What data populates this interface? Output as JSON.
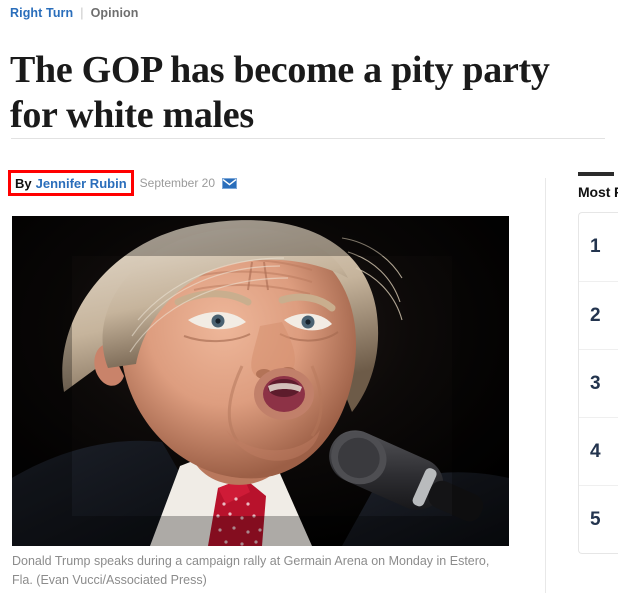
{
  "kicker": {
    "brand": "Right Turn",
    "separator": "|",
    "section": "Opinion"
  },
  "article": {
    "headline": "The GOP has become a pity party\nfor white males",
    "byline_prefix": "By",
    "author": "Jennifer Rubin",
    "date": "September 20",
    "email_icon": "envelope-icon"
  },
  "photo": {
    "caption": "Donald Trump speaks during a campaign rally at Germain Arena on Monday in Estero, Fla. (Evan Vucci/Associated Press)",
    "alt": "Donald Trump speaking into a microphone at a campaign rally"
  },
  "sidebar": {
    "title": "Most R",
    "items": [
      {
        "rank": "1"
      },
      {
        "rank": "2"
      },
      {
        "rank": "3"
      },
      {
        "rank": "4"
      },
      {
        "rank": "5"
      }
    ]
  },
  "colors": {
    "brand_blue": "#2a6ebb",
    "highlight_red": "#ff0000",
    "caption_gray": "#8c8c8c",
    "rail_rank": "#23344e"
  }
}
